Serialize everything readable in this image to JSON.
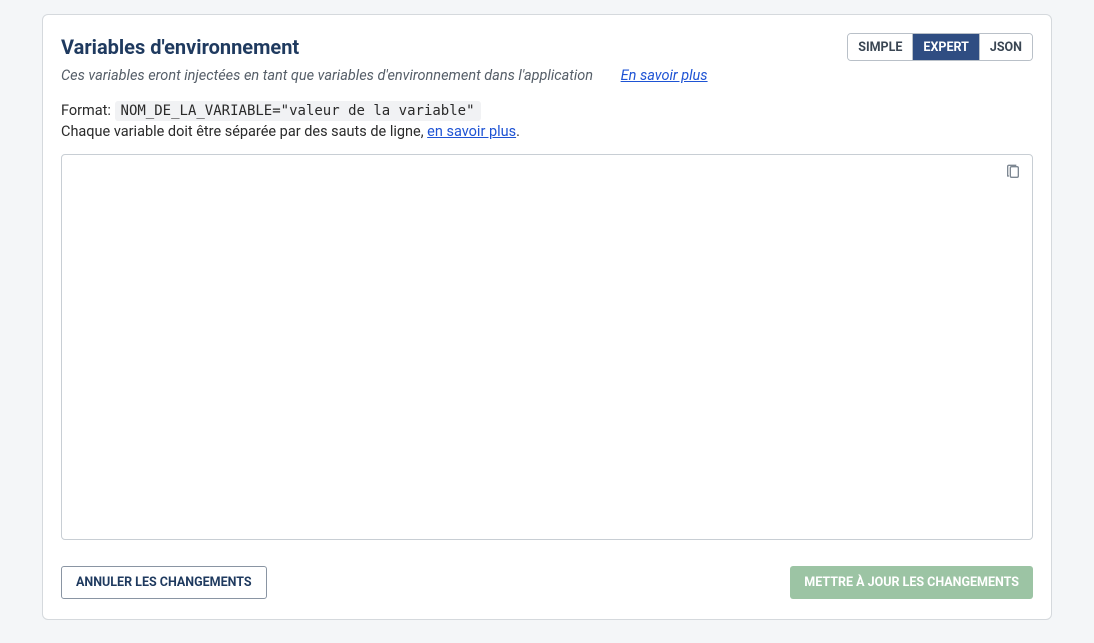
{
  "header": {
    "title": "Variables d'environnement"
  },
  "tabs": {
    "simple": "SIMPLE",
    "expert": "EXPERT",
    "json": "JSON"
  },
  "subtitle": {
    "text": "Ces variables eront injectées en tant que variables d'environnement dans l'application",
    "learn_more": "En savoir plus"
  },
  "format": {
    "label": "Format: ",
    "example": "NOM_DE_LA_VARIABLE=\"valeur de la variable\""
  },
  "separator": {
    "prefix": "Chaque variable doit être séparée par des sauts de ligne, ",
    "link": "en savoir plus",
    "suffix": "."
  },
  "textarea": {
    "value": ""
  },
  "buttons": {
    "cancel": "ANNULER LES CHANGEMENTS",
    "update": "METTRE À JOUR LES CHANGEMENTS"
  }
}
